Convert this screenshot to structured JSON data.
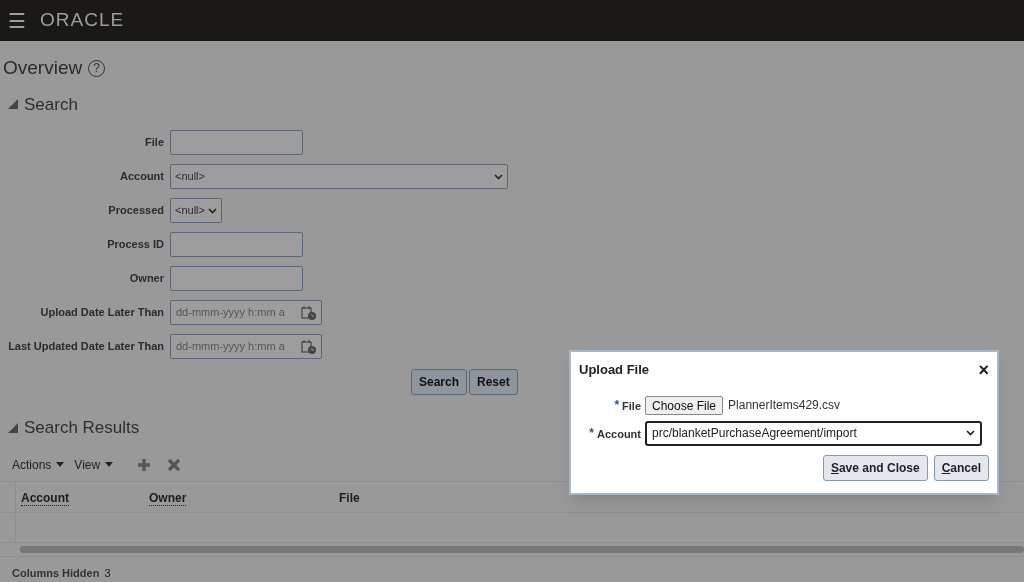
{
  "header": {
    "menu_icon": "☰",
    "brand": "ORACLE"
  },
  "page": {
    "title": "Overview",
    "help": "?"
  },
  "search": {
    "title": "Search",
    "expanded": true,
    "fields": [
      {
        "label": "File",
        "kind": "text"
      },
      {
        "label": "Account",
        "kind": "wideselect",
        "value": "<null>"
      },
      {
        "label": "Processed",
        "kind": "select",
        "value": "<null>"
      },
      {
        "label": "Process ID",
        "kind": "text"
      },
      {
        "label": "Owner",
        "kind": "text"
      },
      {
        "label": "Upload Date Later Than",
        "kind": "date",
        "placeholder": "dd-mmm-yyyy h:mm a"
      },
      {
        "label": "Last Updated Date Later Than",
        "kind": "date",
        "placeholder": "dd-mmm-yyyy h:mm a"
      }
    ],
    "buttons": [
      "Search",
      "Reset"
    ]
  },
  "results": {
    "title": "Search Results",
    "expanded": true,
    "menus": [
      "Actions",
      "View"
    ],
    "columns": [
      {
        "label": "Account",
        "sortable": true
      },
      {
        "label": "Owner",
        "sortable": true
      },
      {
        "label": "File",
        "sortable": false
      }
    ],
    "columns_hidden": {
      "label": "Columns Hidden",
      "count": "3"
    }
  },
  "dialog": {
    "title": "Upload File",
    "close": "×",
    "fields": [
      {
        "label": "File",
        "required_mark": "*",
        "kind": "file",
        "button": "Choose File",
        "value": "PlannerItems429.csv"
      },
      {
        "label": "Account",
        "required_mark": "*",
        "kind": "select",
        "value": "prc/blanketPurchaseAgreement/import"
      }
    ],
    "buttons": [
      {
        "label": "Save and Close",
        "mnemonic": true
      },
      {
        "label": "Cancel",
        "mnemonic": true
      }
    ]
  }
}
